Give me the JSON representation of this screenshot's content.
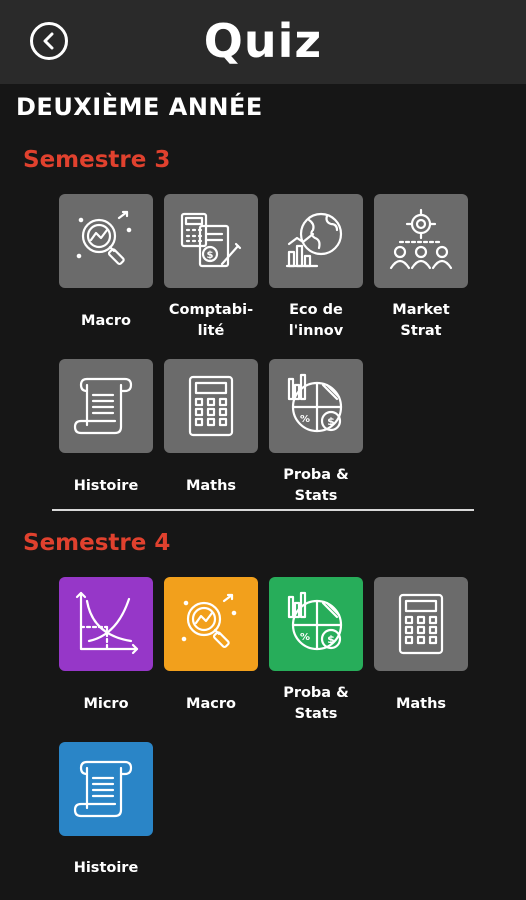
{
  "header": {
    "title": "Quiz",
    "back_icon": "back-arrow-icon"
  },
  "year_title": "DEUXIÈME ANNÉE",
  "semesters": [
    {
      "title": "Semestre 3",
      "items": [
        {
          "label": "Macro",
          "icon": "magnifier-chart-icon",
          "color": "#6b6b6b"
        },
        {
          "label": "Comptabi-\nlité",
          "icon": "calculator-document-icon",
          "color": "#6b6b6b"
        },
        {
          "label": "Eco de\nl'innov",
          "icon": "globe-chart-icon",
          "color": "#6b6b6b"
        },
        {
          "label": "Market\nStrat",
          "icon": "target-audience-icon",
          "color": "#6b6b6b"
        },
        {
          "label": "Histoire",
          "icon": "scroll-icon",
          "color": "#6b6b6b"
        },
        {
          "label": "Maths",
          "icon": "calculator-icon",
          "color": "#6b6b6b"
        },
        {
          "label": "Proba &\nStats",
          "icon": "pie-chart-dollar-icon",
          "color": "#6b6b6b"
        }
      ]
    },
    {
      "title": "Semestre 4",
      "items": [
        {
          "label": "Micro",
          "icon": "supply-demand-graph-icon",
          "color": "#9637c8"
        },
        {
          "label": "Macro",
          "icon": "magnifier-chart-icon",
          "color": "#f2a01c"
        },
        {
          "label": "Proba &\nStats",
          "icon": "pie-chart-dollar-icon",
          "color": "#27ad5a"
        },
        {
          "label": "Maths",
          "icon": "calculator-icon",
          "color": "#6b6b6b"
        },
        {
          "label": "Histoire",
          "icon": "scroll-icon",
          "color": "#2a85c7"
        }
      ]
    }
  ]
}
